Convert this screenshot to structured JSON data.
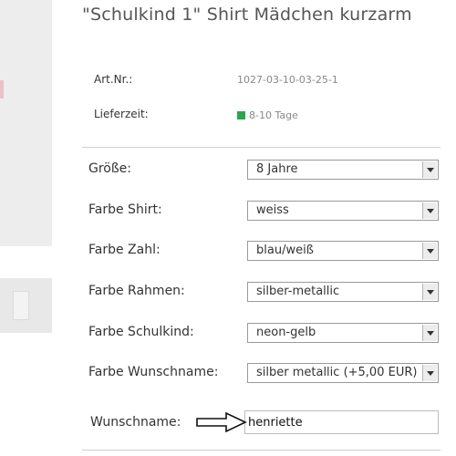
{
  "product": {
    "title": "\"Schulkind 1\" Shirt Mädchen kurzarm",
    "art_nr_label": "Art.Nr.:",
    "art_nr_value": "1027-03-10-03-25-1",
    "delivery_label": "Lieferzeit:",
    "delivery_value": "8-10 Tage",
    "availability_color": "#2aa84a"
  },
  "options": [
    {
      "label": "Größe:",
      "value": "8 Jahre"
    },
    {
      "label": "Farbe Shirt:",
      "value": "weiss"
    },
    {
      "label": "Farbe Zahl:",
      "value": "blau/weiß"
    },
    {
      "label": "Farbe Rahmen:",
      "value": "silber-metallic"
    },
    {
      "label": "Farbe Schulkind:",
      "value": "neon-gelb"
    },
    {
      "label": "Farbe Wunschname:",
      "value": "silber metallic (+5,00 EUR)"
    }
  ],
  "custom_name": {
    "label": "Wunschname:",
    "value": "henriette"
  },
  "icons": {
    "dropdown": "chevron-down-icon",
    "annotation": "arrow-right-icon"
  }
}
